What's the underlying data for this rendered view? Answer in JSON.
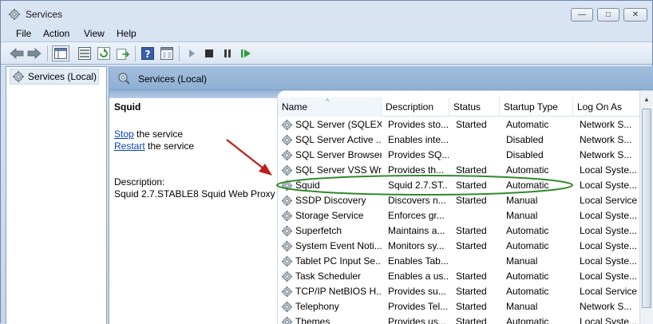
{
  "window": {
    "title": "Services",
    "controls": {
      "minimize": "—",
      "maximize": "□",
      "close": "✕"
    }
  },
  "menu": [
    "File",
    "Action",
    "View",
    "Help"
  ],
  "toolbar": {
    "icons": [
      "back-icon",
      "forward-icon",
      "show-console-tree-icon",
      "properties-list-icon",
      "refresh-icon",
      "export-list-icon",
      "help-icon",
      "console-view-icon",
      "start-service-icon",
      "stop-service-icon",
      "pause-service-icon",
      "restart-service-icon"
    ]
  },
  "tree": {
    "root_label": "Services (Local)"
  },
  "main": {
    "header_title": "Services (Local)",
    "detail": {
      "service_name": "Squid",
      "stop_link": "Stop",
      "stop_suffix": " the service",
      "restart_link": "Restart",
      "restart_suffix": " the service",
      "description_label": "Description:",
      "description_text": "Squid 2.7.STABLE8 Squid Web Proxy"
    }
  },
  "table": {
    "columns": [
      "Name",
      "Description",
      "Status",
      "Startup Type",
      "Log On As"
    ],
    "sort_glyph": "^",
    "rows": [
      {
        "name": "SQL Server (SQLEX...",
        "description": "Provides sto...",
        "status": "Started",
        "startup": "Automatic",
        "logon": "Network S..."
      },
      {
        "name": "SQL Server Active ...",
        "description": "Enables inte...",
        "status": "",
        "startup": "Disabled",
        "logon": "Network S..."
      },
      {
        "name": "SQL Server Browser",
        "description": "Provides SQ...",
        "status": "",
        "startup": "Disabled",
        "logon": "Network S..."
      },
      {
        "name": "SQL Server VSS Wr...",
        "description": "Provides th...",
        "status": "Started",
        "startup": "Automatic",
        "logon": "Local Syste..."
      },
      {
        "name": "Squid",
        "description": "Squid 2.7.ST...",
        "status": "Started",
        "startup": "Automatic",
        "logon": "Local Syste..."
      },
      {
        "name": "SSDP Discovery",
        "description": "Discovers n...",
        "status": "Started",
        "startup": "Manual",
        "logon": "Local Service"
      },
      {
        "name": "Storage Service",
        "description": "Enforces gr...",
        "status": "",
        "startup": "Manual",
        "logon": "Local Syste..."
      },
      {
        "name": "Superfetch",
        "description": "Maintains a...",
        "status": "Started",
        "startup": "Automatic",
        "logon": "Local Syste..."
      },
      {
        "name": "System Event Noti...",
        "description": "Monitors sy...",
        "status": "Started",
        "startup": "Automatic",
        "logon": "Local Syste..."
      },
      {
        "name": "Tablet PC Input Se...",
        "description": "Enables Tab...",
        "status": "",
        "startup": "Manual",
        "logon": "Local Syste..."
      },
      {
        "name": "Task Scheduler",
        "description": "Enables a us...",
        "status": "Started",
        "startup": "Automatic",
        "logon": "Local Syste..."
      },
      {
        "name": "TCP/IP NetBIOS H...",
        "description": "Provides su...",
        "status": "Started",
        "startup": "Automatic",
        "logon": "Local Service"
      },
      {
        "name": "Telephony",
        "description": "Provides Tel...",
        "status": "Started",
        "startup": "Manual",
        "logon": "Network S..."
      },
      {
        "name": "Themes",
        "description": "Provides us...",
        "status": "Started",
        "startup": "Automatic",
        "logon": "Local Syste..."
      }
    ],
    "highlighted_row": 4
  },
  "colors": {
    "annotation_arrow": "#c0201c",
    "annotation_ellipse": "#2f8a2a",
    "link": "#0b46b8"
  }
}
